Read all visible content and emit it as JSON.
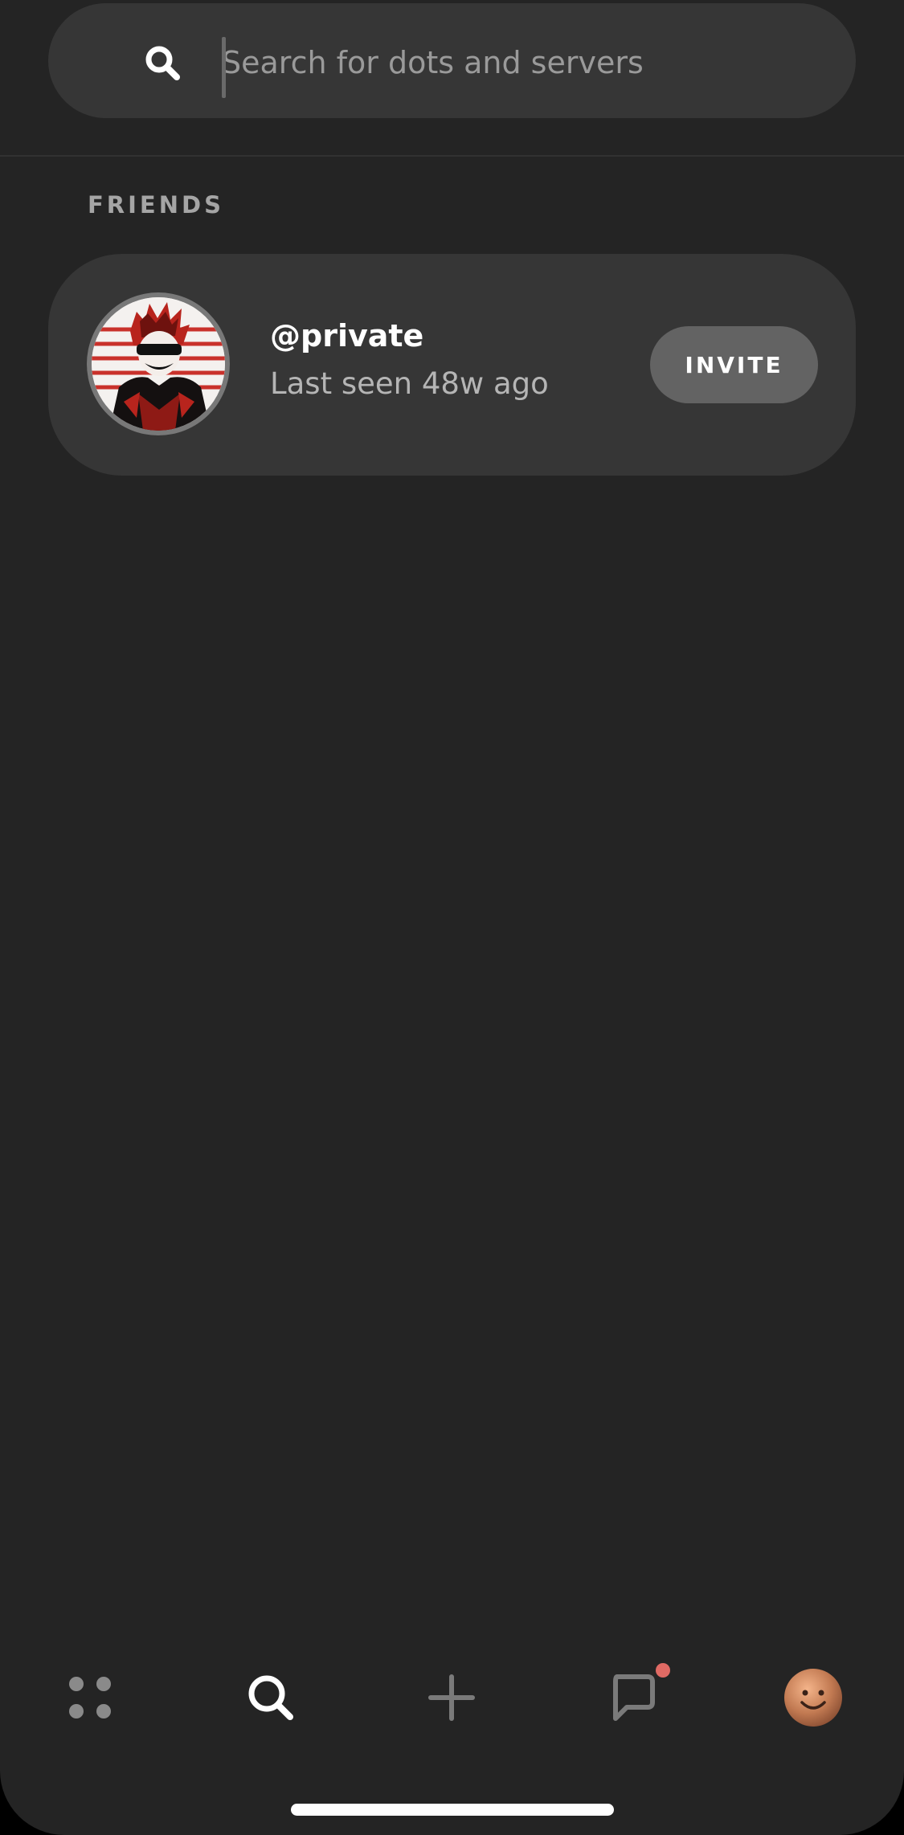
{
  "search": {
    "placeholder": "Search for dots and servers",
    "value": ""
  },
  "friends": {
    "section_title": "FRIENDS",
    "items": [
      {
        "username": "@private",
        "status": "Last seen 48w ago",
        "action_label": "INVITE"
      }
    ]
  },
  "bottom_nav": {
    "items": [
      {
        "icon": "grid-dots-icon",
        "active": false
      },
      {
        "icon": "search-icon",
        "active": true
      },
      {
        "icon": "plus-icon",
        "active": false
      },
      {
        "icon": "chat-bubble-icon",
        "active": false,
        "has_notification": true
      },
      {
        "icon": "profile-avatar-icon",
        "active": false
      }
    ]
  },
  "colors": {
    "background": "#242424",
    "card": "#363636",
    "invite_button": "#636363",
    "notification": "#e06a64"
  }
}
